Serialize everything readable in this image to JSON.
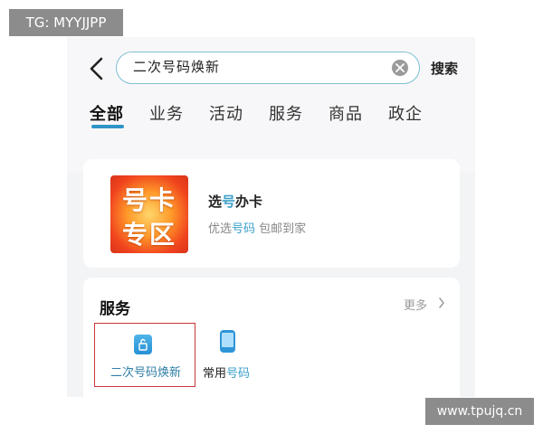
{
  "overlay": {
    "tg_label": "TG: MYYJJPP",
    "watermark": "www.tpujq.cn"
  },
  "search": {
    "query": "二次号码焕新",
    "button": "搜索"
  },
  "tabs": [
    {
      "label": "全部",
      "active": true
    },
    {
      "label": "业务"
    },
    {
      "label": "活动"
    },
    {
      "label": "服务"
    },
    {
      "label": "商品"
    },
    {
      "label": "政企"
    }
  ],
  "promo": {
    "badge_line1": "号卡",
    "badge_line2": "专区",
    "title_a": "选",
    "title_b": "号",
    "title_c": "办卡",
    "sub_a": "优选",
    "sub_b": "号码",
    "sub_c": " 包邮到家"
  },
  "services": {
    "title": "服务",
    "more": "更多",
    "items": [
      {
        "label": "二次号码焕新",
        "icon": "lock-phone-icon"
      },
      {
        "label_a": "常用",
        "label_b": "号码",
        "icon": "smartphone-icon"
      }
    ]
  },
  "colors": {
    "accent": "#2f95c7",
    "highlight": "#3a9fc9",
    "selection_border": "#c8383a"
  }
}
